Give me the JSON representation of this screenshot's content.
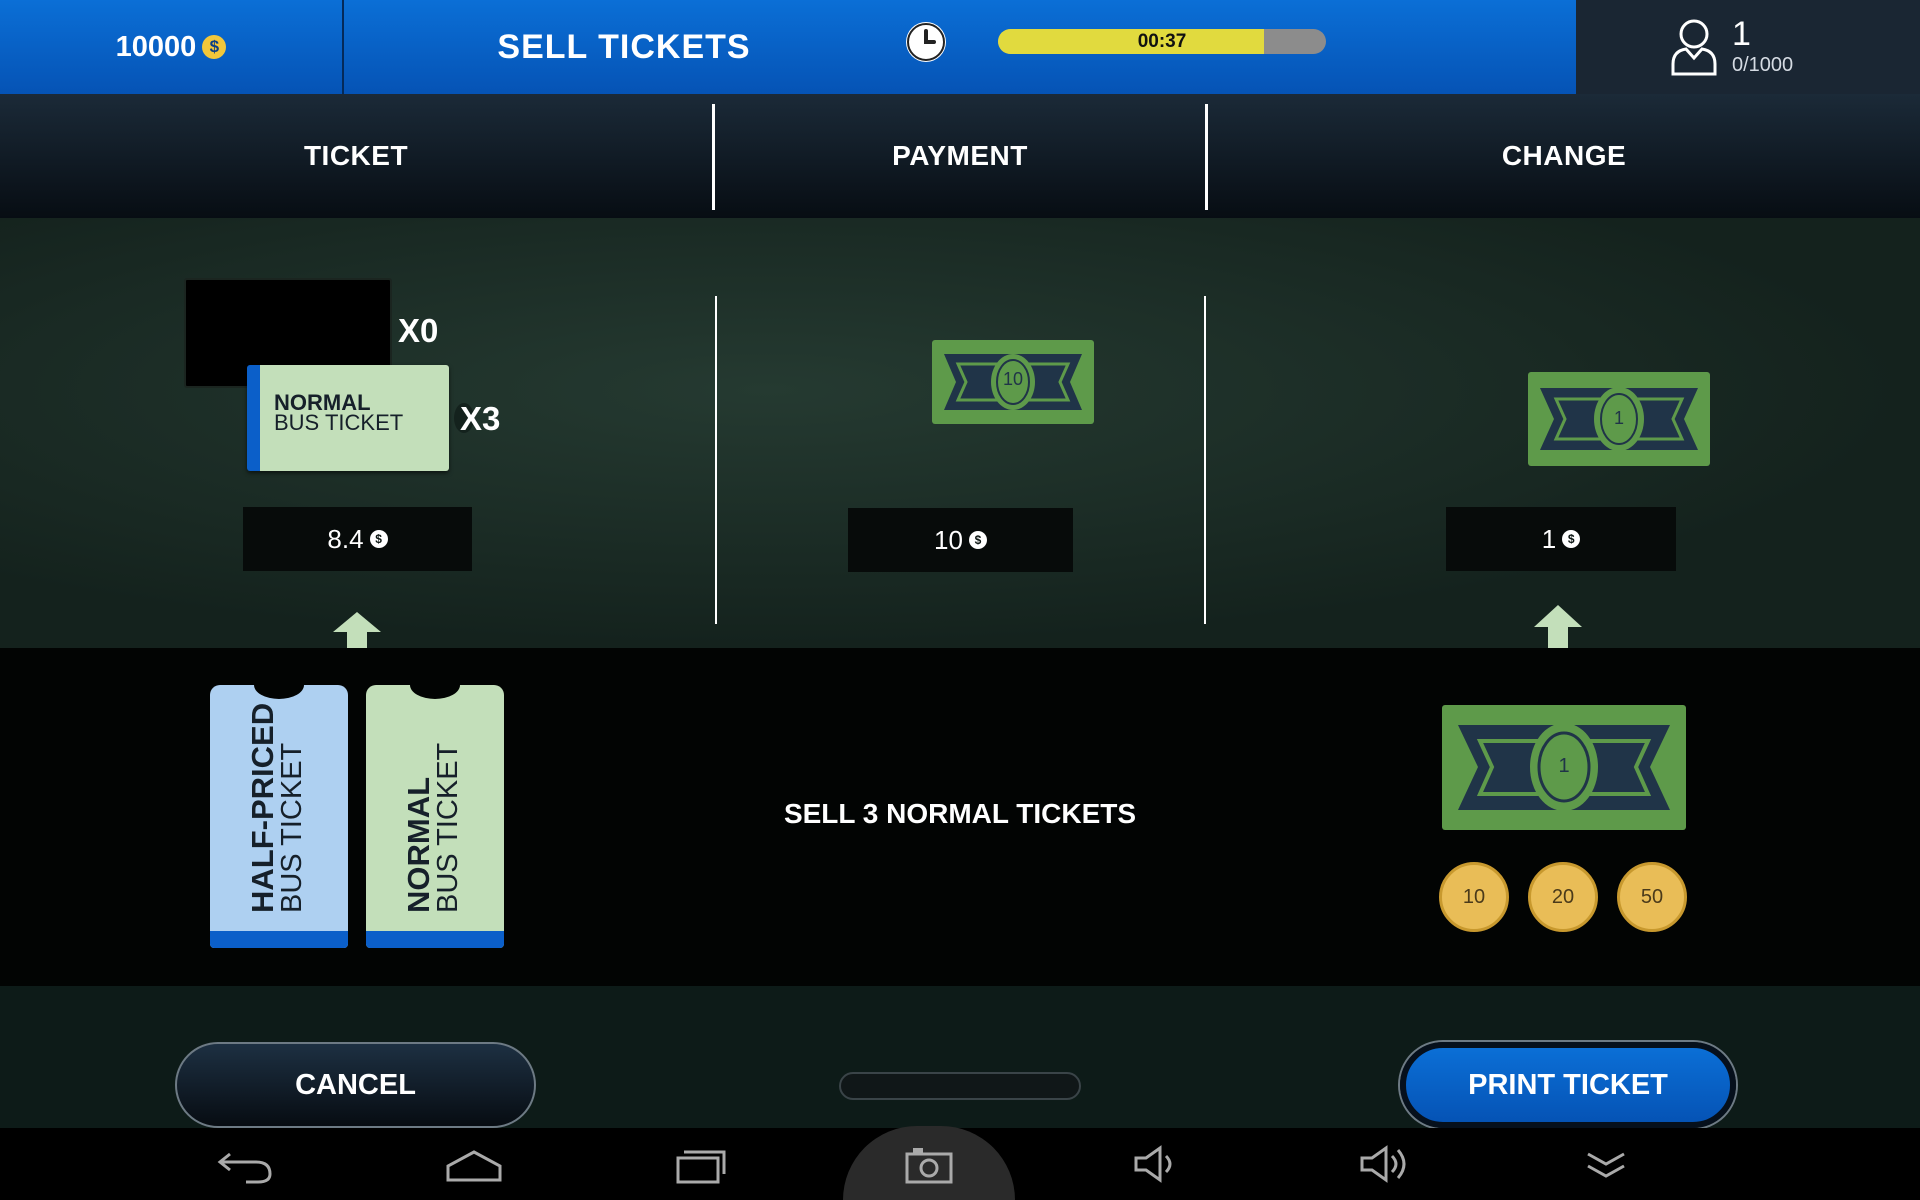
{
  "header": {
    "coins": "10000",
    "coin_symbol": "$",
    "title": "SELL TICKETS",
    "timer": "00:37",
    "timer_progress": 0.81,
    "players_count": "1",
    "players_total": "0/1000"
  },
  "columns": {
    "ticket": "TICKET",
    "payment": "PAYMENT",
    "change": "CHANGE"
  },
  "ticket_area": {
    "half_count": "X0",
    "normal_count": "X3",
    "normal_ticket_line1": "NORMAL",
    "normal_ticket_line2": "BUS TICKET",
    "price": "8.4"
  },
  "payment_area": {
    "bill_value": "10",
    "amount": "10"
  },
  "change_area": {
    "bill_value": "1",
    "amount": "1"
  },
  "lower": {
    "half_ticket_line1": "HALF-PRICED",
    "half_ticket_line2": "BUS TICKET",
    "normal_ticket_line1": "NORMAL",
    "normal_ticket_line2": "BUS TICKET",
    "instruction": "SELL 3 NORMAL TICKETS",
    "bill_value": "1",
    "coins": [
      "10",
      "20",
      "50"
    ]
  },
  "buttons": {
    "cancel": "CANCEL",
    "print": "PRINT TICKET"
  },
  "colors": {
    "header_blue": "#0553b5",
    "half_ticket": "#aed0f1",
    "normal_ticket": "#c3dfba",
    "bill_green": "#5e9a4a",
    "coin_gold": "#e9bd57"
  }
}
